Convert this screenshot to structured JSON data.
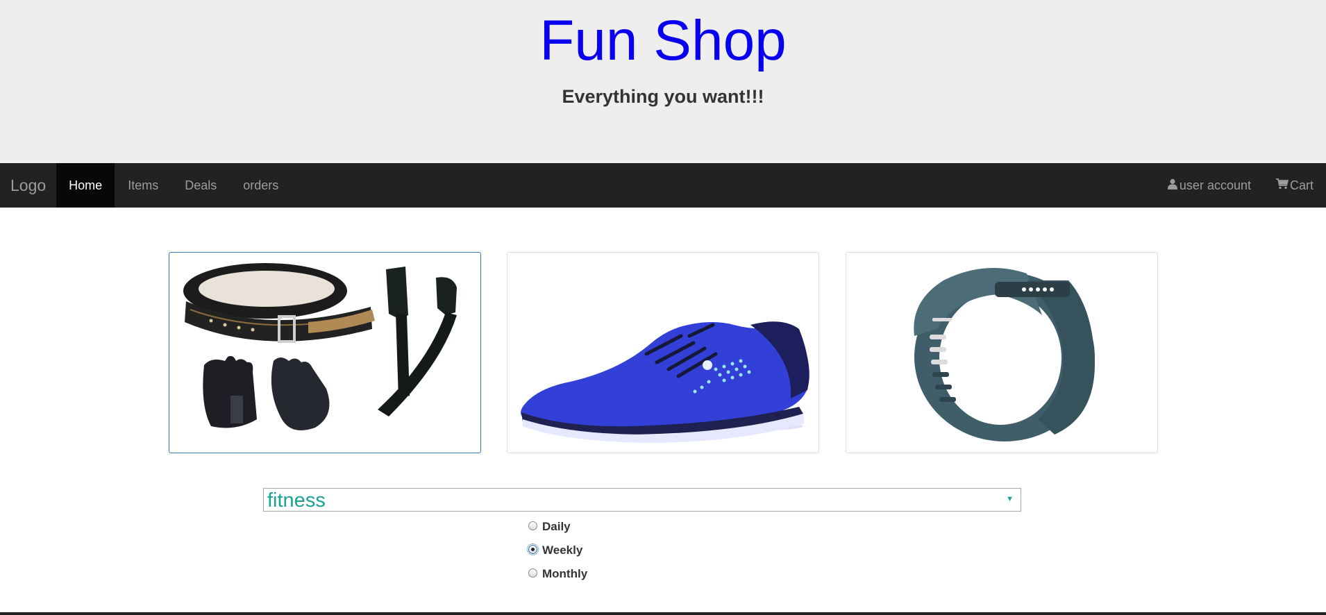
{
  "header": {
    "title": "Fun Shop",
    "tagline": "Everything you want!!!"
  },
  "navbar": {
    "brand": "Logo",
    "links": [
      {
        "label": "Home",
        "active": true
      },
      {
        "label": "Items",
        "active": false
      },
      {
        "label": "Deals",
        "active": false
      },
      {
        "label": "orders",
        "active": false
      }
    ],
    "user_account": {
      "label": "user account",
      "icon": "user-icon"
    },
    "cart": {
      "label": "Cart",
      "icon": "cart-icon"
    }
  },
  "products": [
    {
      "name": "lifting-belt-gloves-straps",
      "selected": true
    },
    {
      "name": "blue-running-shoe",
      "selected": false
    },
    {
      "name": "fitness-tracker-band",
      "selected": false
    }
  ],
  "category_select": {
    "value": "fitness"
  },
  "frequency": {
    "options": [
      "Daily",
      "Weekly",
      "Monthly"
    ],
    "selected": "Weekly"
  },
  "colors": {
    "title": "#0a00f0",
    "select_text": "#1aa394",
    "navbar": "#222222"
  }
}
